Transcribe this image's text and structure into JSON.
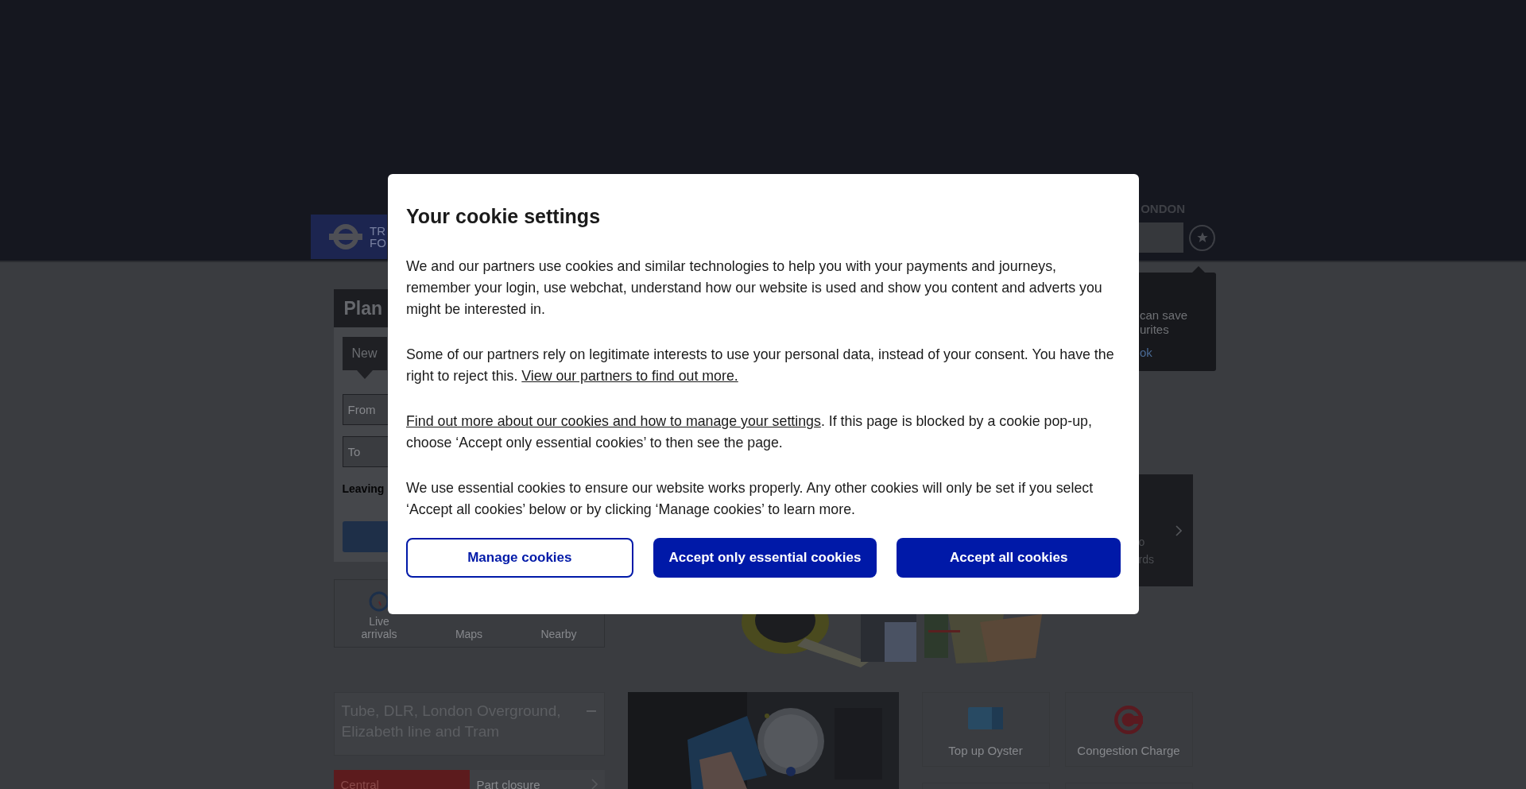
{
  "header": {
    "logo_lines": [
      "TR",
      "FO"
    ],
    "region_label": "ONDON"
  },
  "favourites_tooltip": {
    "lines": [
      "can save",
      "urites"
    ],
    "link": "ok"
  },
  "journey_planner": {
    "title": "Plan",
    "tabs": [
      {
        "label": "New",
        "selected": true
      }
    ],
    "from_placeholder": "From",
    "to_placeholder": "To",
    "leaving_label": "Leaving"
  },
  "quick_links": [
    {
      "kind": "arrivals",
      "label": "Live arrivals"
    },
    {
      "kind": "maps",
      "label": "Maps"
    },
    {
      "kind": "nearby",
      "label": "Nearby"
    }
  ],
  "promo_banner": {
    "lines": [
      "o",
      "rds"
    ]
  },
  "status": {
    "title": "Tube, DLR, London Overground, Elizabeth line and Tram",
    "expanded": true,
    "lines": [
      {
        "name": "Central",
        "color": "#5c1b1d",
        "status": "Part closure"
      }
    ]
  },
  "tiles": [
    {
      "kind": "oyster",
      "label": "Top up Oyster"
    },
    {
      "kind": "congestion",
      "label": "Congestion Charge"
    }
  ],
  "cookie_dialog": {
    "title": "Your cookie settings",
    "paragraphs": [
      [
        {
          "kind": "text",
          "text": "We and our partners use cookies and similar technologies to help you with your payments and journeys, remember your login, use webchat, understand how our website is used and show you content and adverts you might be interested in."
        }
      ],
      [
        {
          "kind": "text",
          "text": "Some of our partners rely on legitimate interests to use your personal data, instead of your consent. You have the right to reject this. "
        },
        {
          "kind": "link",
          "text": "View our partners to find out more."
        }
      ],
      [
        {
          "kind": "link",
          "text": "Find out more about our cookies and how to manage your settings"
        },
        {
          "kind": "text",
          "text": ". If this page is blocked by a cookie pop-up, choose ‘Accept only essential cookies’ to then see the page."
        }
      ],
      [
        {
          "kind": "text",
          "text": "We use essential cookies to ensure our website works properly. Any other cookies will only be set if you select ‘Accept all cookies’ below or by clicking ‘Manage cookies’ to learn more."
        }
      ]
    ],
    "buttons": [
      {
        "kind": "outline",
        "label": "Manage cookies"
      },
      {
        "kind": "filled",
        "label": "Accept only essential cookies"
      },
      {
        "kind": "filled",
        "label": "Accept all cookies"
      }
    ]
  }
}
